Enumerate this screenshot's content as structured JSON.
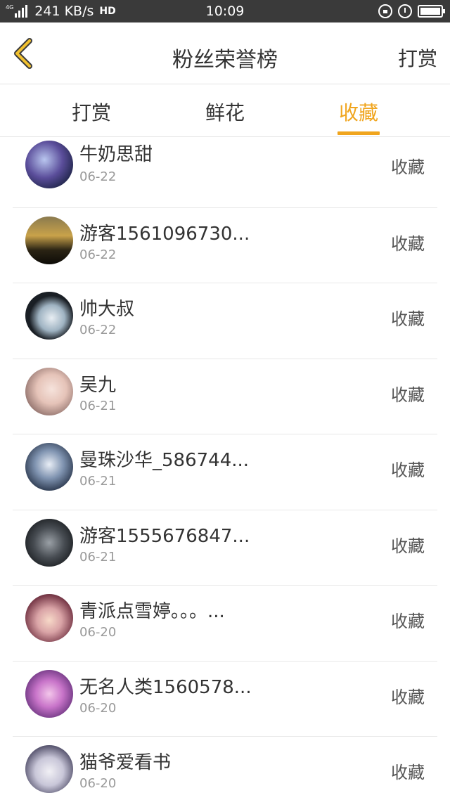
{
  "status_bar": {
    "network": "4G",
    "speed": "241 KB/s",
    "hd": "HD",
    "time": "10:09"
  },
  "header": {
    "title": "粉丝荣誉榜",
    "right_action": "打赏",
    "back_icon": "chevron-left-icon",
    "accent_color": "#f0a51e"
  },
  "tabs": [
    {
      "label": "打赏",
      "active": false
    },
    {
      "label": "鲜花",
      "active": false
    },
    {
      "label": "收藏",
      "active": true
    }
  ],
  "fans": [
    {
      "name": "牛奶思甜",
      "date": "06-22",
      "action": "收藏"
    },
    {
      "name": "游客1561096730...",
      "date": "06-22",
      "action": "收藏"
    },
    {
      "name": "帅大叔",
      "date": "06-22",
      "action": "收藏"
    },
    {
      "name": "吴九",
      "date": "06-21",
      "action": "收藏"
    },
    {
      "name": "曼珠沙华_586744...",
      "date": "06-21",
      "action": "收藏"
    },
    {
      "name": "游客1555676847...",
      "date": "06-21",
      "action": "收藏"
    },
    {
      "name": "青派点雪婷。。。...",
      "date": "06-20",
      "action": "收藏"
    },
    {
      "name": "无名人类1560578...",
      "date": "06-20",
      "action": "收藏"
    },
    {
      "name": "猫爷爱看书",
      "date": "06-20",
      "action": "收藏"
    }
  ]
}
